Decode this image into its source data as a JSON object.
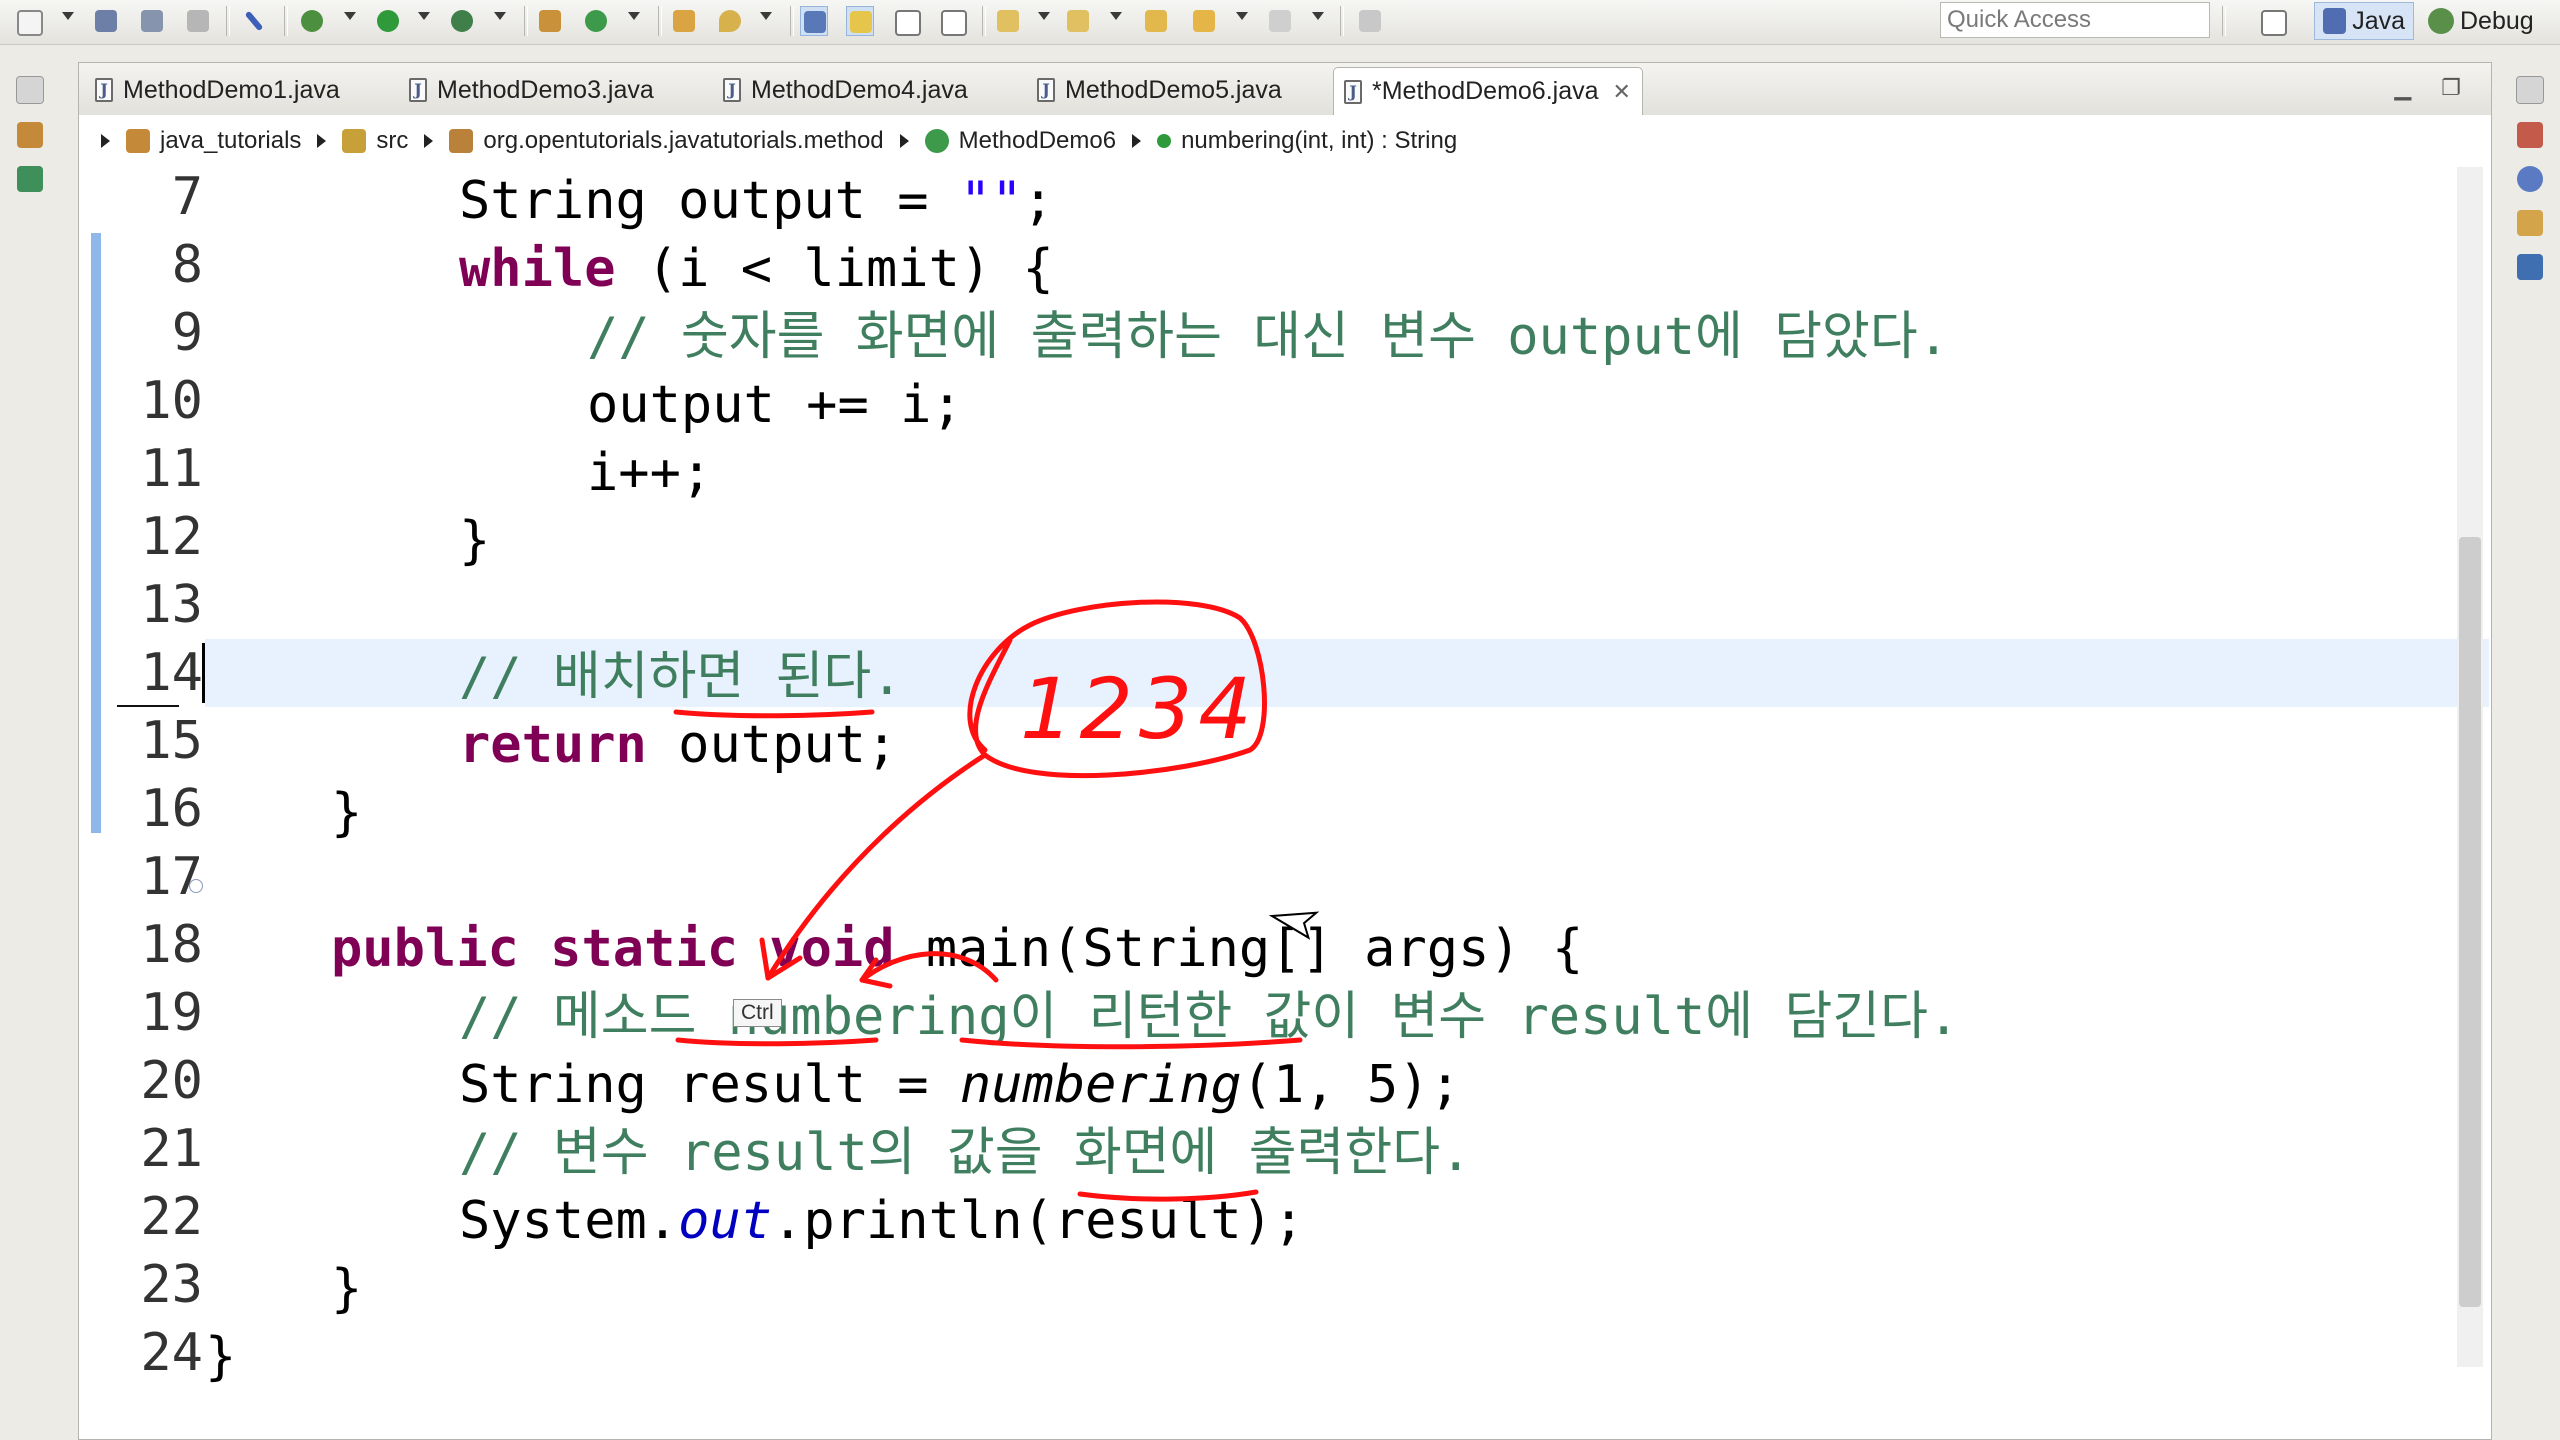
{
  "toolbar": {
    "quick_access_placeholder": "Quick Access",
    "perspectives": [
      {
        "label": "Java",
        "icon": "java-perspective-icon",
        "active": true
      },
      {
        "label": "Debug",
        "icon": "debug-perspective-icon",
        "active": false
      }
    ]
  },
  "tabs": [
    {
      "label": "MethodDemo1.java",
      "active": false
    },
    {
      "label": "MethodDemo3.java",
      "active": false
    },
    {
      "label": "MethodDemo4.java",
      "active": false
    },
    {
      "label": "MethodDemo5.java",
      "active": false
    },
    {
      "label": "*MethodDemo6.java",
      "active": true
    }
  ],
  "breadcrumb": {
    "project": "java_tutorials",
    "folder": "src",
    "package": "org.opentutorials.javatutorials.method",
    "class": "MethodDemo6",
    "method": "numbering(int, int) : String"
  },
  "editor": {
    "line_numbers": [
      "7",
      "8",
      "9",
      "10",
      "11",
      "12",
      "13",
      "14",
      "15",
      "16",
      "17",
      "18",
      "19",
      "20",
      "21",
      "22",
      "23",
      "24"
    ],
    "current_line": "13",
    "lines": {
      "l7": {
        "a": "String output = ",
        "b": "\"\"",
        "c": ";"
      },
      "l8": {
        "a": "while",
        "b": " (i < limit) {"
      },
      "l9": {
        "a": "// 숫자를 화면에 출력하는 대신 변수 output에 담았다."
      },
      "l10": {
        "a": "output += i;"
      },
      "l11": {
        "a": "i++;"
      },
      "l12": {
        "a": "}"
      },
      "l13": {
        "a": "// 배치하면 된다."
      },
      "l14": {
        "a": "return",
        "b": " output;"
      },
      "l15": {
        "a": "}"
      },
      "l17": {
        "a": "public",
        "b": " ",
        "c": "static",
        "d": " ",
        "e": "void",
        "f": " main(String[] args) {"
      },
      "l18": {
        "a": "// 메소드 numbering이 리턴한 값이 변수 result에 담긴다."
      },
      "l19": {
        "a": "String result = ",
        "b": "numbering",
        "c": "(1, 5);"
      },
      "l20": {
        "a": "// 변수 result의 값을 화면에 출력한다."
      },
      "l21": {
        "a": "System.",
        "b": "out",
        "c": ".println(result);"
      },
      "l22": {
        "a": "}"
      },
      "l23": {
        "a": "}"
      }
    },
    "tooltip": "Ctrl",
    "annotation_text": "1234"
  },
  "colors": {
    "keyword": "#7f0055",
    "comment": "#3f7f5f",
    "string": "#2a00ff",
    "static_field": "#0000c0",
    "current_line_highlight": "#e8f2fe",
    "annotation_pen": "#ff1010"
  }
}
